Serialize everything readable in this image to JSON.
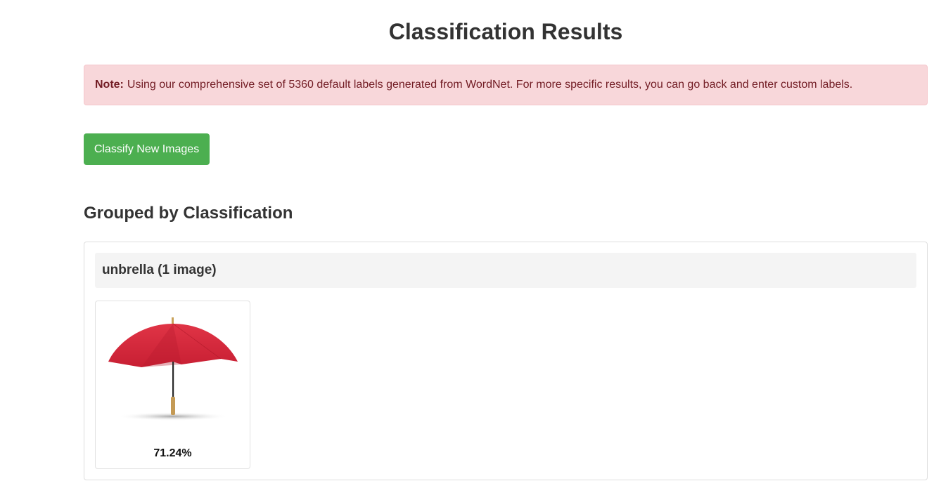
{
  "page": {
    "title": "Classification Results"
  },
  "note": {
    "label": "Note:",
    "text": "Using our comprehensive set of 5360 default labels generated from WordNet. For more specific results, you can go back and enter custom labels."
  },
  "actions": {
    "classify_new_label": "Classify New Images"
  },
  "section": {
    "title": "Grouped by Classification"
  },
  "groups": [
    {
      "header": "unbrella (1 image)",
      "images": [
        {
          "subject": "red-umbrella-image",
          "confidence": "71.24%"
        }
      ]
    }
  ],
  "colors": {
    "note_bg": "#f8d7da",
    "note_text": "#721c24",
    "button_bg": "#4caf50",
    "umbrella": "#d6263a"
  }
}
